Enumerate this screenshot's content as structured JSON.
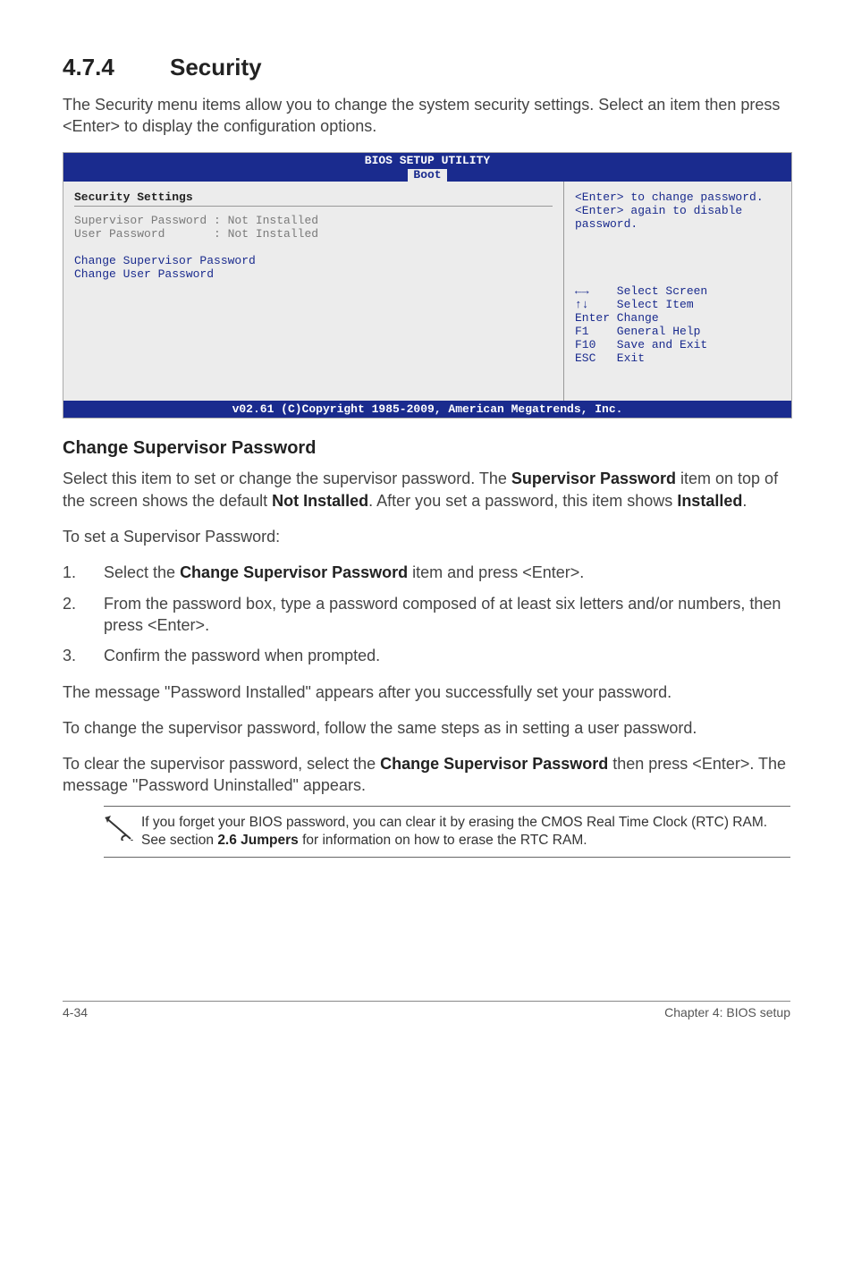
{
  "section": {
    "number": "4.7.4",
    "title": "Security"
  },
  "intro": "The Security menu items allow you to change the system security settings. Select an item then press <Enter> to display the configuration options.",
  "bios": {
    "header_title": "BIOS SETUP UTILITY",
    "tab": "Boot",
    "left": {
      "section_label": "Security Settings",
      "line1": "Supervisor Password : Not Installed",
      "line2": "User Password       : Not Installed",
      "opt1": "Change Supervisor Password",
      "opt2": "Change User Password"
    },
    "right": {
      "help1": "<Enter> to change password.",
      "help2": "<Enter> again to disable password.",
      "nav1": "←→    Select Screen",
      "nav2": "↑↓    Select Item",
      "nav3": "Enter Change",
      "nav4": "F1    General Help",
      "nav5": "F10   Save and Exit",
      "nav6": "ESC   Exit"
    },
    "footer": "v02.61 (C)Copyright 1985-2009, American Megatrends, Inc."
  },
  "chg_sup_heading": "Change Supervisor Password",
  "para1_a": "Select this item to set or change the supervisor password. The ",
  "para1_b": "Supervisor Password",
  "para1_c": " item on top of the screen shows the default ",
  "para1_d": "Not Installed",
  "para1_e": ". After you set a password, this item shows ",
  "para1_f": "Installed",
  "para1_g": ".",
  "para2": "To set a Supervisor Password:",
  "steps": {
    "s1a": "Select the ",
    "s1b": "Change Supervisor Password",
    "s1c": " item and press <Enter>.",
    "s2": "From the password box, type a password composed of at least six letters and/or numbers, then press <Enter>.",
    "s3": "Confirm the password when prompted."
  },
  "para3": "The message \"Password Installed\" appears after you successfully set your password.",
  "para4": "To change the supervisor password, follow the same steps as in setting a user password.",
  "para5_a": "To clear the supervisor password, select the ",
  "para5_b": "Change Supervisor Password",
  "para5_c": " then press <Enter>. The message \"Password Uninstalled\" appears.",
  "note_a": "If you forget your BIOS password, you can clear it by erasing the CMOS Real Time Clock (RTC) RAM. See section ",
  "note_b": "2.6 Jumpers",
  "note_c": " for information on how to erase the RTC RAM.",
  "footer_left": "4-34",
  "footer_right": "Chapter 4: BIOS setup"
}
